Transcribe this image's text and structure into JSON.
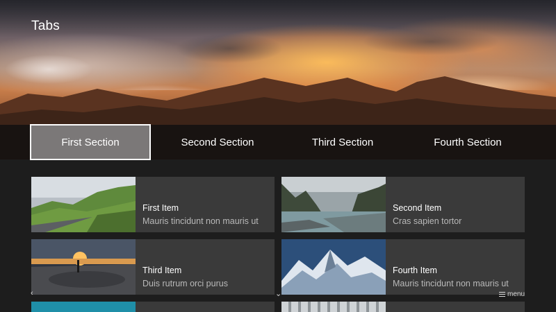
{
  "header": {
    "title": "Tabs"
  },
  "tabs": [
    {
      "label": "First Section",
      "active": true
    },
    {
      "label": "Second Section",
      "active": false
    },
    {
      "label": "Third Section",
      "active": false
    },
    {
      "label": "Fourth Section",
      "active": false
    }
  ],
  "items": [
    {
      "title": "First Item",
      "subtitle": "Mauris tincidunt non mauris ut"
    },
    {
      "title": "Second Item",
      "subtitle": "Cras sapien tortor"
    },
    {
      "title": "Third Item",
      "subtitle": "Duis rutrum orci purus"
    },
    {
      "title": "Fourth Item",
      "subtitle": "Mauris tincidunt non mauris ut"
    }
  ],
  "footer": {
    "left_glyph": "‹",
    "mid_glyph": "⌄",
    "menu_label": "menu"
  },
  "colors": {
    "tab_active_bg": "#7b7878",
    "card_bg": "#3a3a3a",
    "page_bg": "#1d1d1d"
  }
}
